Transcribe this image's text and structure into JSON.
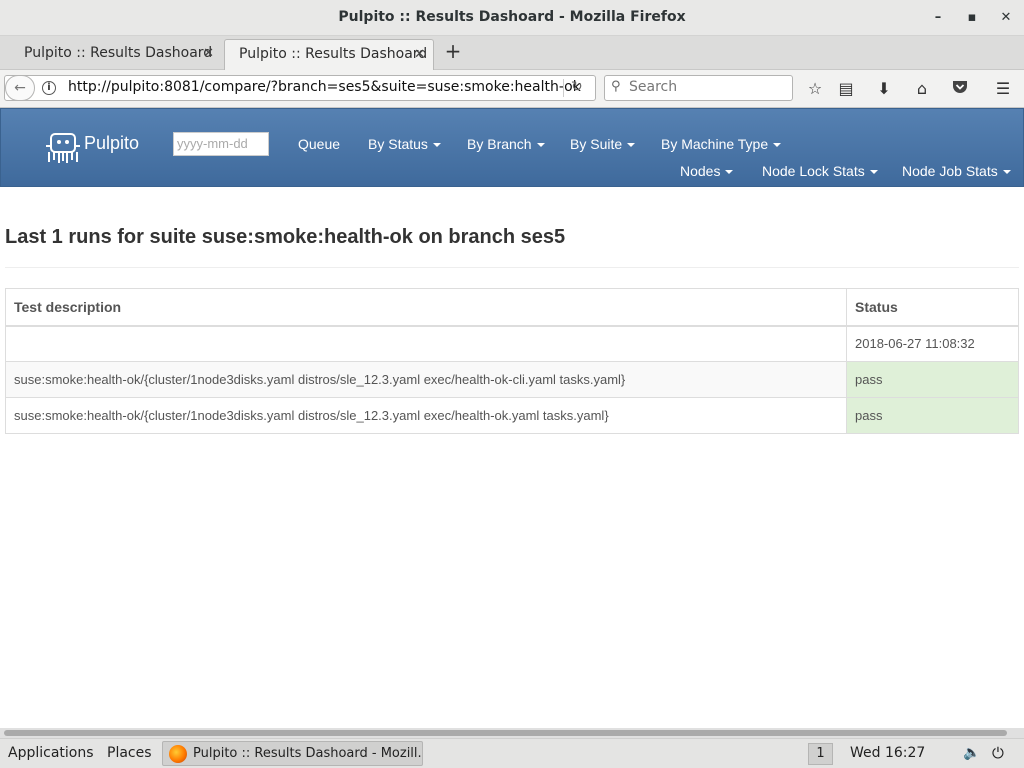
{
  "window": {
    "title": "Pulpito :: Results Dashoard - Mozilla Firefox",
    "min_glyph": "–",
    "max_glyph": "▪",
    "close_glyph": "✕"
  },
  "tabs": [
    {
      "label": "Pulpito :: Results Dashoard",
      "active": false
    },
    {
      "label": "Pulpito :: Results Dashoard",
      "active": true
    }
  ],
  "toolbar": {
    "url": "http://pulpito:8081/compare/?branch=ses5&suite=suse:smoke:health-ok",
    "search_placeholder": "Search",
    "icons": [
      "back-icon",
      "info-icon",
      "reload-icon",
      "search-icon",
      "bookmark-star-icon",
      "reader-list-icon",
      "download-icon",
      "home-icon",
      "pocket-icon",
      "hamburger-menu-icon"
    ]
  },
  "pulpito_nav": {
    "brand": "Pulpito",
    "date_placeholder": "yyyy-mm-dd",
    "links": [
      "Queue",
      "By Status",
      "By Branch",
      "By Suite",
      "By Machine Type",
      "Nodes",
      "Node Lock Stats",
      "Node Job Stats"
    ]
  },
  "page": {
    "title": "Last 1 runs for suite suse:smoke:health-ok on branch ses5"
  },
  "results_table": {
    "headers": [
      "Test description",
      "Status"
    ],
    "run_row": {
      "description": "",
      "status": "2018-06-27 11:08:32"
    },
    "rows": [
      {
        "description": "suse:smoke:health-ok/{cluster/1node3disks.yaml distros/sle_12.3.yaml exec/health-ok-cli.yaml tasks.yaml}",
        "status": "pass"
      },
      {
        "description": "suse:smoke:health-ok/{cluster/1node3disks.yaml distros/sle_12.3.yaml exec/health-ok.yaml tasks.yaml}",
        "status": "pass"
      }
    ]
  },
  "taskbar": {
    "applications": "Applications",
    "places": "Places",
    "window_label": "Pulpito :: Results Dashoard - Mozill...",
    "workspace": "1",
    "clock": "Wed 16:27"
  },
  "colors": {
    "navbar": "#4b76a6",
    "pass_bg": "#dff0d8",
    "title_bar": "#e8e8e7"
  }
}
